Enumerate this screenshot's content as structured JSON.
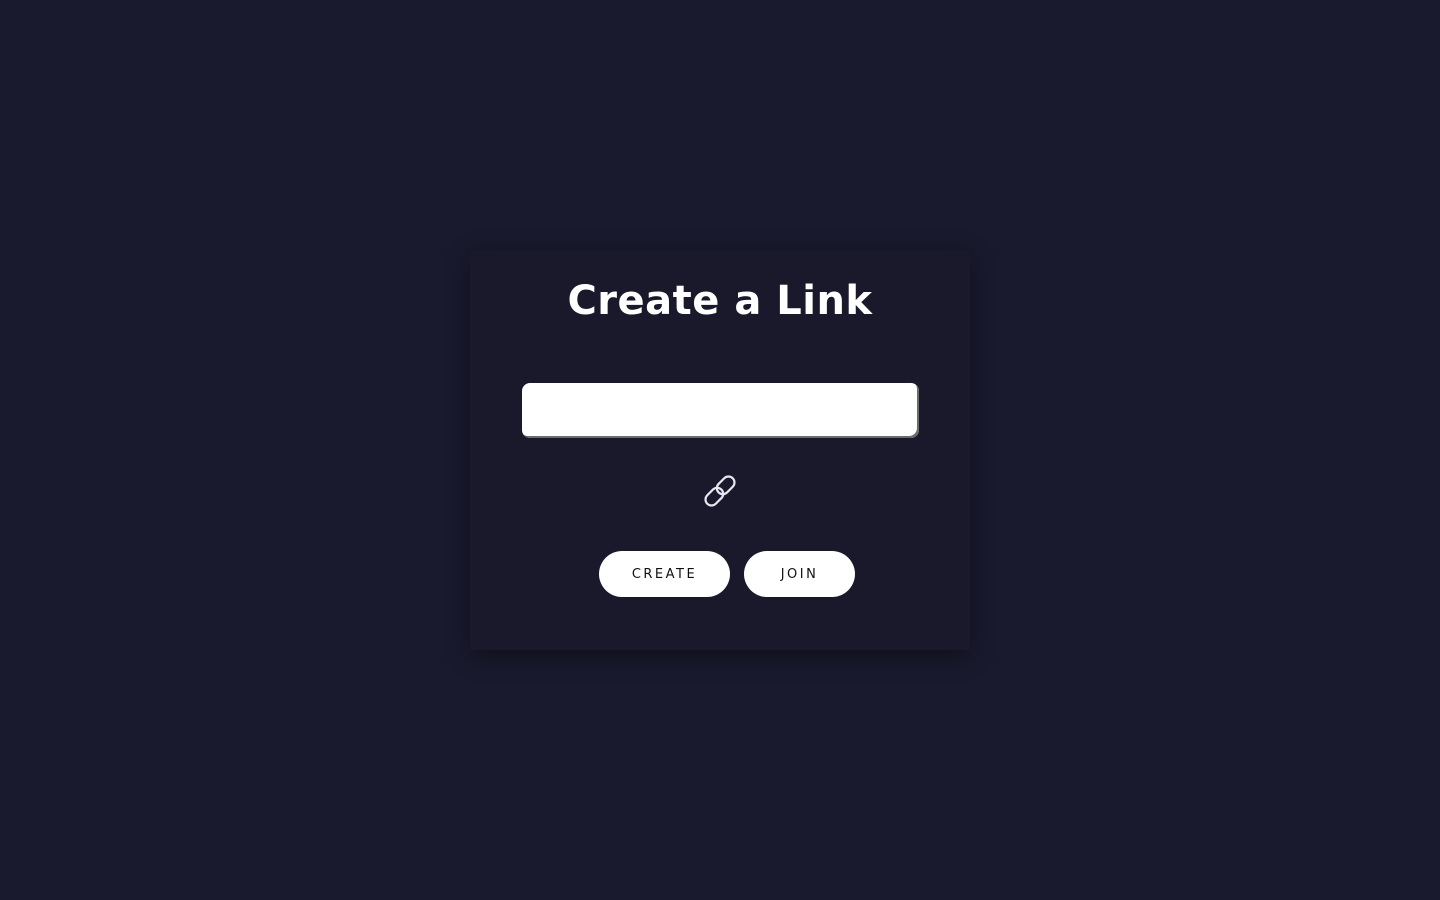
{
  "card": {
    "title": "Create a Link"
  },
  "input": {
    "value": "",
    "placeholder": ""
  },
  "icons": {
    "chain": "link-icon"
  },
  "buttons": {
    "create_label": "CREATE",
    "join_label": "JOIN"
  },
  "colors": {
    "background": "#1a1a2e",
    "card": "#1a182b",
    "text": "#ffffff",
    "button": "#ffffff",
    "button_text": "#111111"
  }
}
